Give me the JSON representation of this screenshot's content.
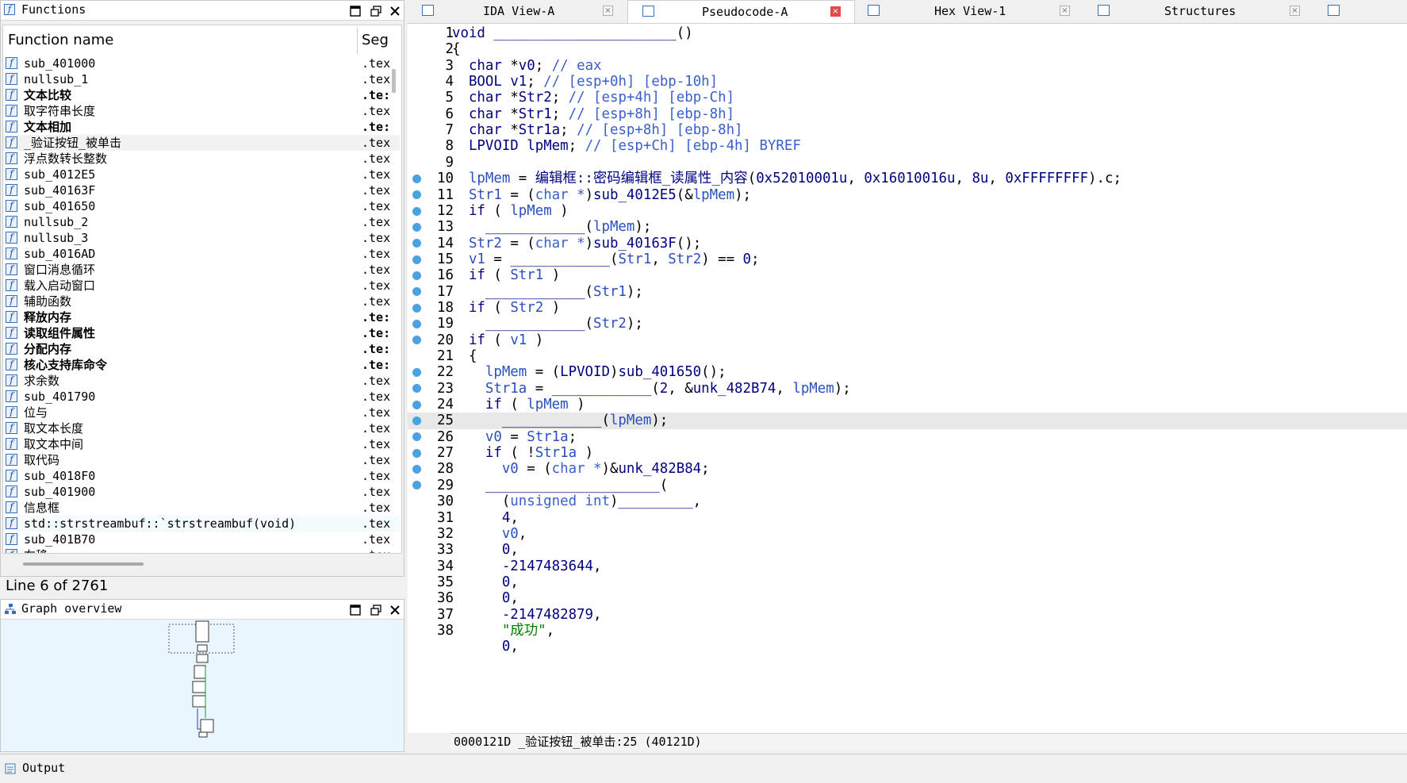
{
  "functions_panel": {
    "title": "Functions",
    "col_name": "Function name",
    "col_seg": "Seg",
    "rows": [
      {
        "name": "sub_401000",
        "seg": ".tex",
        "bold": false
      },
      {
        "name": "nullsub_1",
        "seg": ".tex",
        "bold": false
      },
      {
        "name": "文本比较",
        "seg": ".te:",
        "bold": true
      },
      {
        "name": "取字符串长度",
        "seg": ".tex",
        "bold": false
      },
      {
        "name": "文本相加",
        "seg": ".te:",
        "bold": true
      },
      {
        "name": "_验证按钮_被单击",
        "seg": ".tex",
        "bold": false
      },
      {
        "name": "浮点数转长整数",
        "seg": ".tex",
        "bold": false
      },
      {
        "name": "sub_4012E5",
        "seg": ".tex",
        "bold": false
      },
      {
        "name": "sub_40163F",
        "seg": ".tex",
        "bold": false
      },
      {
        "name": "sub_401650",
        "seg": ".tex",
        "bold": false
      },
      {
        "name": "nullsub_2",
        "seg": ".tex",
        "bold": false
      },
      {
        "name": "nullsub_3",
        "seg": ".tex",
        "bold": false
      },
      {
        "name": "sub_4016AD",
        "seg": ".tex",
        "bold": false
      },
      {
        "name": "窗口消息循环",
        "seg": ".tex",
        "bold": false
      },
      {
        "name": "载入启动窗口",
        "seg": ".tex",
        "bold": false
      },
      {
        "name": "辅助函数",
        "seg": ".tex",
        "bold": false
      },
      {
        "name": "释放内存",
        "seg": ".te:",
        "bold": true
      },
      {
        "name": "读取组件属性",
        "seg": ".te:",
        "bold": true
      },
      {
        "name": "分配内存",
        "seg": ".te:",
        "bold": true
      },
      {
        "name": "核心支持库命令",
        "seg": ".te:",
        "bold": true
      },
      {
        "name": "求余数",
        "seg": ".tex",
        "bold": false
      },
      {
        "name": "sub_401790",
        "seg": ".tex",
        "bold": false
      },
      {
        "name": "位与",
        "seg": ".tex",
        "bold": false
      },
      {
        "name": "取文本长度",
        "seg": ".tex",
        "bold": false
      },
      {
        "name": "取文本中间",
        "seg": ".tex",
        "bold": false
      },
      {
        "name": "取代码",
        "seg": ".tex",
        "bold": false
      },
      {
        "name": "sub_4018F0",
        "seg": ".tex",
        "bold": false
      },
      {
        "name": "sub_401900",
        "seg": ".tex",
        "bold": false
      },
      {
        "name": "信息框",
        "seg": ".tex",
        "bold": false
      },
      {
        "name": "std::strstreambuf::`strstreambuf(void)",
        "seg": ".tex",
        "bold": false
      },
      {
        "name": "sub_401B70",
        "seg": ".tex",
        "bold": false
      },
      {
        "name": "右移",
        "seg": ".tex",
        "bold": false
      }
    ],
    "line_status": "Line 6 of 2761"
  },
  "graph_panel": {
    "title": "Graph overview"
  },
  "tabs": [
    {
      "label": "IDA View-A"
    },
    {
      "label": "Pseudocode-A"
    },
    {
      "label": "Hex View-1"
    },
    {
      "label": "Structures"
    }
  ],
  "code_lines": [
    {
      "n": "1",
      "bp": false,
      "html": "<span class='kw'>void</span> <span class='kw'>______________________</span>()"
    },
    {
      "n": "2",
      "bp": false,
      "html": "{"
    },
    {
      "n": "3",
      "bp": false,
      "html": "  <span class='kw'>char</span> *<span class='kw'>v0</span>; <span class='cm'>// eax</span>"
    },
    {
      "n": "4",
      "bp": false,
      "html": "  <span class='kw'>BOOL</span> <span class='kw'>v1</span>; <span class='cm'>// [esp+0h] [ebp-10h]</span>"
    },
    {
      "n": "5",
      "bp": false,
      "html": "  <span class='kw'>char</span> *<span class='kw'>Str2</span>; <span class='cm'>// [esp+4h] [ebp-Ch]</span>"
    },
    {
      "n": "6",
      "bp": false,
      "html": "  <span class='kw'>char</span> *<span class='kw'>Str1</span>; <span class='cm'>// [esp+8h] [ebp-8h]</span>"
    },
    {
      "n": "7",
      "bp": false,
      "html": "  <span class='kw'>char</span> *<span class='kw'>Str1a</span>; <span class='cm'>// [esp+8h] [ebp-8h]</span>"
    },
    {
      "n": "8",
      "bp": false,
      "html": "  <span class='kw'>LPVOID</span> <span class='kw'>lpMem</span>; <span class='cm'>// [esp+Ch] [ebp-4h] BYREF</span>"
    },
    {
      "n": "9",
      "bp": false,
      "html": ""
    },
    {
      "n": "10",
      "bp": true,
      "html": "  <span class='vr'>lpMem</span> = <span class='kw'>编辑框::密码编辑框_读属性_内容</span>(<span class='nm'>0x52010001u</span>, <span class='nm'>0x16010016u</span>, <span class='nm'>8u</span>, <span class='nm'>0xFFFFFFFF</span>).c;"
    },
    {
      "n": "11",
      "bp": true,
      "html": "  <span class='vr'>Str1</span> = (<span class='cm'>char *</span>)<span class='kw'>sub_4012E5</span>(&amp;<span class='vr'>lpMem</span>);"
    },
    {
      "n": "12",
      "bp": true,
      "html": "  <span class='kw'>if</span> ( <span class='vr'>lpMem</span> )"
    },
    {
      "n": "13",
      "bp": true,
      "html": "    <span class='kw'>____________</span>(<span class='vr'>lpMem</span>);"
    },
    {
      "n": "14",
      "bp": true,
      "html": "  <span class='vr'>Str2</span> = (<span class='cm'>char *</span>)<span class='kw'>sub_40163F</span>();"
    },
    {
      "n": "15",
      "bp": true,
      "html": "  <span class='vr'>v1</span> = <span class='kw'>____________</span>(<span class='vr'>Str1</span>, <span class='vr'>Str2</span>) == <span class='nm'>0</span>;"
    },
    {
      "n": "16",
      "bp": true,
      "html": "  <span class='kw'>if</span> ( <span class='vr'>Str1</span> )"
    },
    {
      "n": "17",
      "bp": true,
      "html": "    <span class='kw'>____________</span>(<span class='vr'>Str1</span>);"
    },
    {
      "n": "18",
      "bp": true,
      "html": "  <span class='kw'>if</span> ( <span class='vr'>Str2</span> )"
    },
    {
      "n": "19",
      "bp": true,
      "html": "    <span class='kw'>____________</span>(<span class='vr'>Str2</span>);"
    },
    {
      "n": "20",
      "bp": true,
      "html": "  <span class='kw'>if</span> ( <span class='vr'>v1</span> )"
    },
    {
      "n": "21",
      "bp": false,
      "html": "  {"
    },
    {
      "n": "22",
      "bp": true,
      "html": "    <span class='vr'>lpMem</span> = (<span class='kw'>LPVOID</span>)<span class='kw'>sub_401650</span>();"
    },
    {
      "n": "23",
      "bp": true,
      "html": "    <span class='vr'>Str1a</span> = <span class='kw'>____________</span>(<span class='nm'>2</span>, &amp;<span class='kw'>unk_482B74</span>, <span class='vr'>lpMem</span>);"
    },
    {
      "n": "24",
      "bp": true,
      "html": "    <span class='kw'>if</span> ( <span class='vr'>lpMem</span> )"
    },
    {
      "n": "25",
      "bp": true,
      "cur": true,
      "html": "      <span class='kw'>____________</span>(<span class='vr'>lpMem</span>);"
    },
    {
      "n": "26",
      "bp": true,
      "html": "    <span class='vr'>v0</span> = <span class='vr'>Str1a</span>;"
    },
    {
      "n": "27",
      "bp": true,
      "html": "    <span class='kw'>if</span> ( !<span class='vr'>Str1a</span> )"
    },
    {
      "n": "28",
      "bp": true,
      "html": "      <span class='vr'>v0</span> = (<span class='cm'>char *</span>)&amp;<span class='kw'>unk_482B84</span>;"
    },
    {
      "n": "29",
      "bp": true,
      "html": "    <span class='kw'>_____________________</span>("
    },
    {
      "n": "30",
      "bp": false,
      "html": "      (<span class='cm'>unsigned int</span>)<span class='kw'>_________</span>,"
    },
    {
      "n": "31",
      "bp": false,
      "html": "      <span class='nm'>4</span>,"
    },
    {
      "n": "32",
      "bp": false,
      "html": "      <span class='vr'>v0</span>,"
    },
    {
      "n": "33",
      "bp": false,
      "html": "      <span class='nm'>0</span>,"
    },
    {
      "n": "34",
      "bp": false,
      "html": "      <span class='nm'>-2147483644</span>,"
    },
    {
      "n": "35",
      "bp": false,
      "html": "      <span class='nm'>0</span>,"
    },
    {
      "n": "36",
      "bp": false,
      "html": "      <span class='nm'>0</span>,"
    },
    {
      "n": "37",
      "bp": false,
      "html": "      <span class='nm'>-2147482879</span>,"
    },
    {
      "n": "38",
      "bp": false,
      "html": "      <span class='st'>\"成功\"</span>,"
    },
    {
      "n": "",
      "bp": false,
      "html": "      <span class='nm'>0</span>,"
    }
  ],
  "status_strip": "0000121D _验证按钮_被单击:25 (40121D)",
  "output_panel": {
    "title": "Output"
  },
  "icons": {
    "function": "function-icon",
    "minimize": "minimize-icon",
    "restore": "restore-icon",
    "close": "close-icon",
    "graph": "graph-icon",
    "output": "output-icon"
  }
}
